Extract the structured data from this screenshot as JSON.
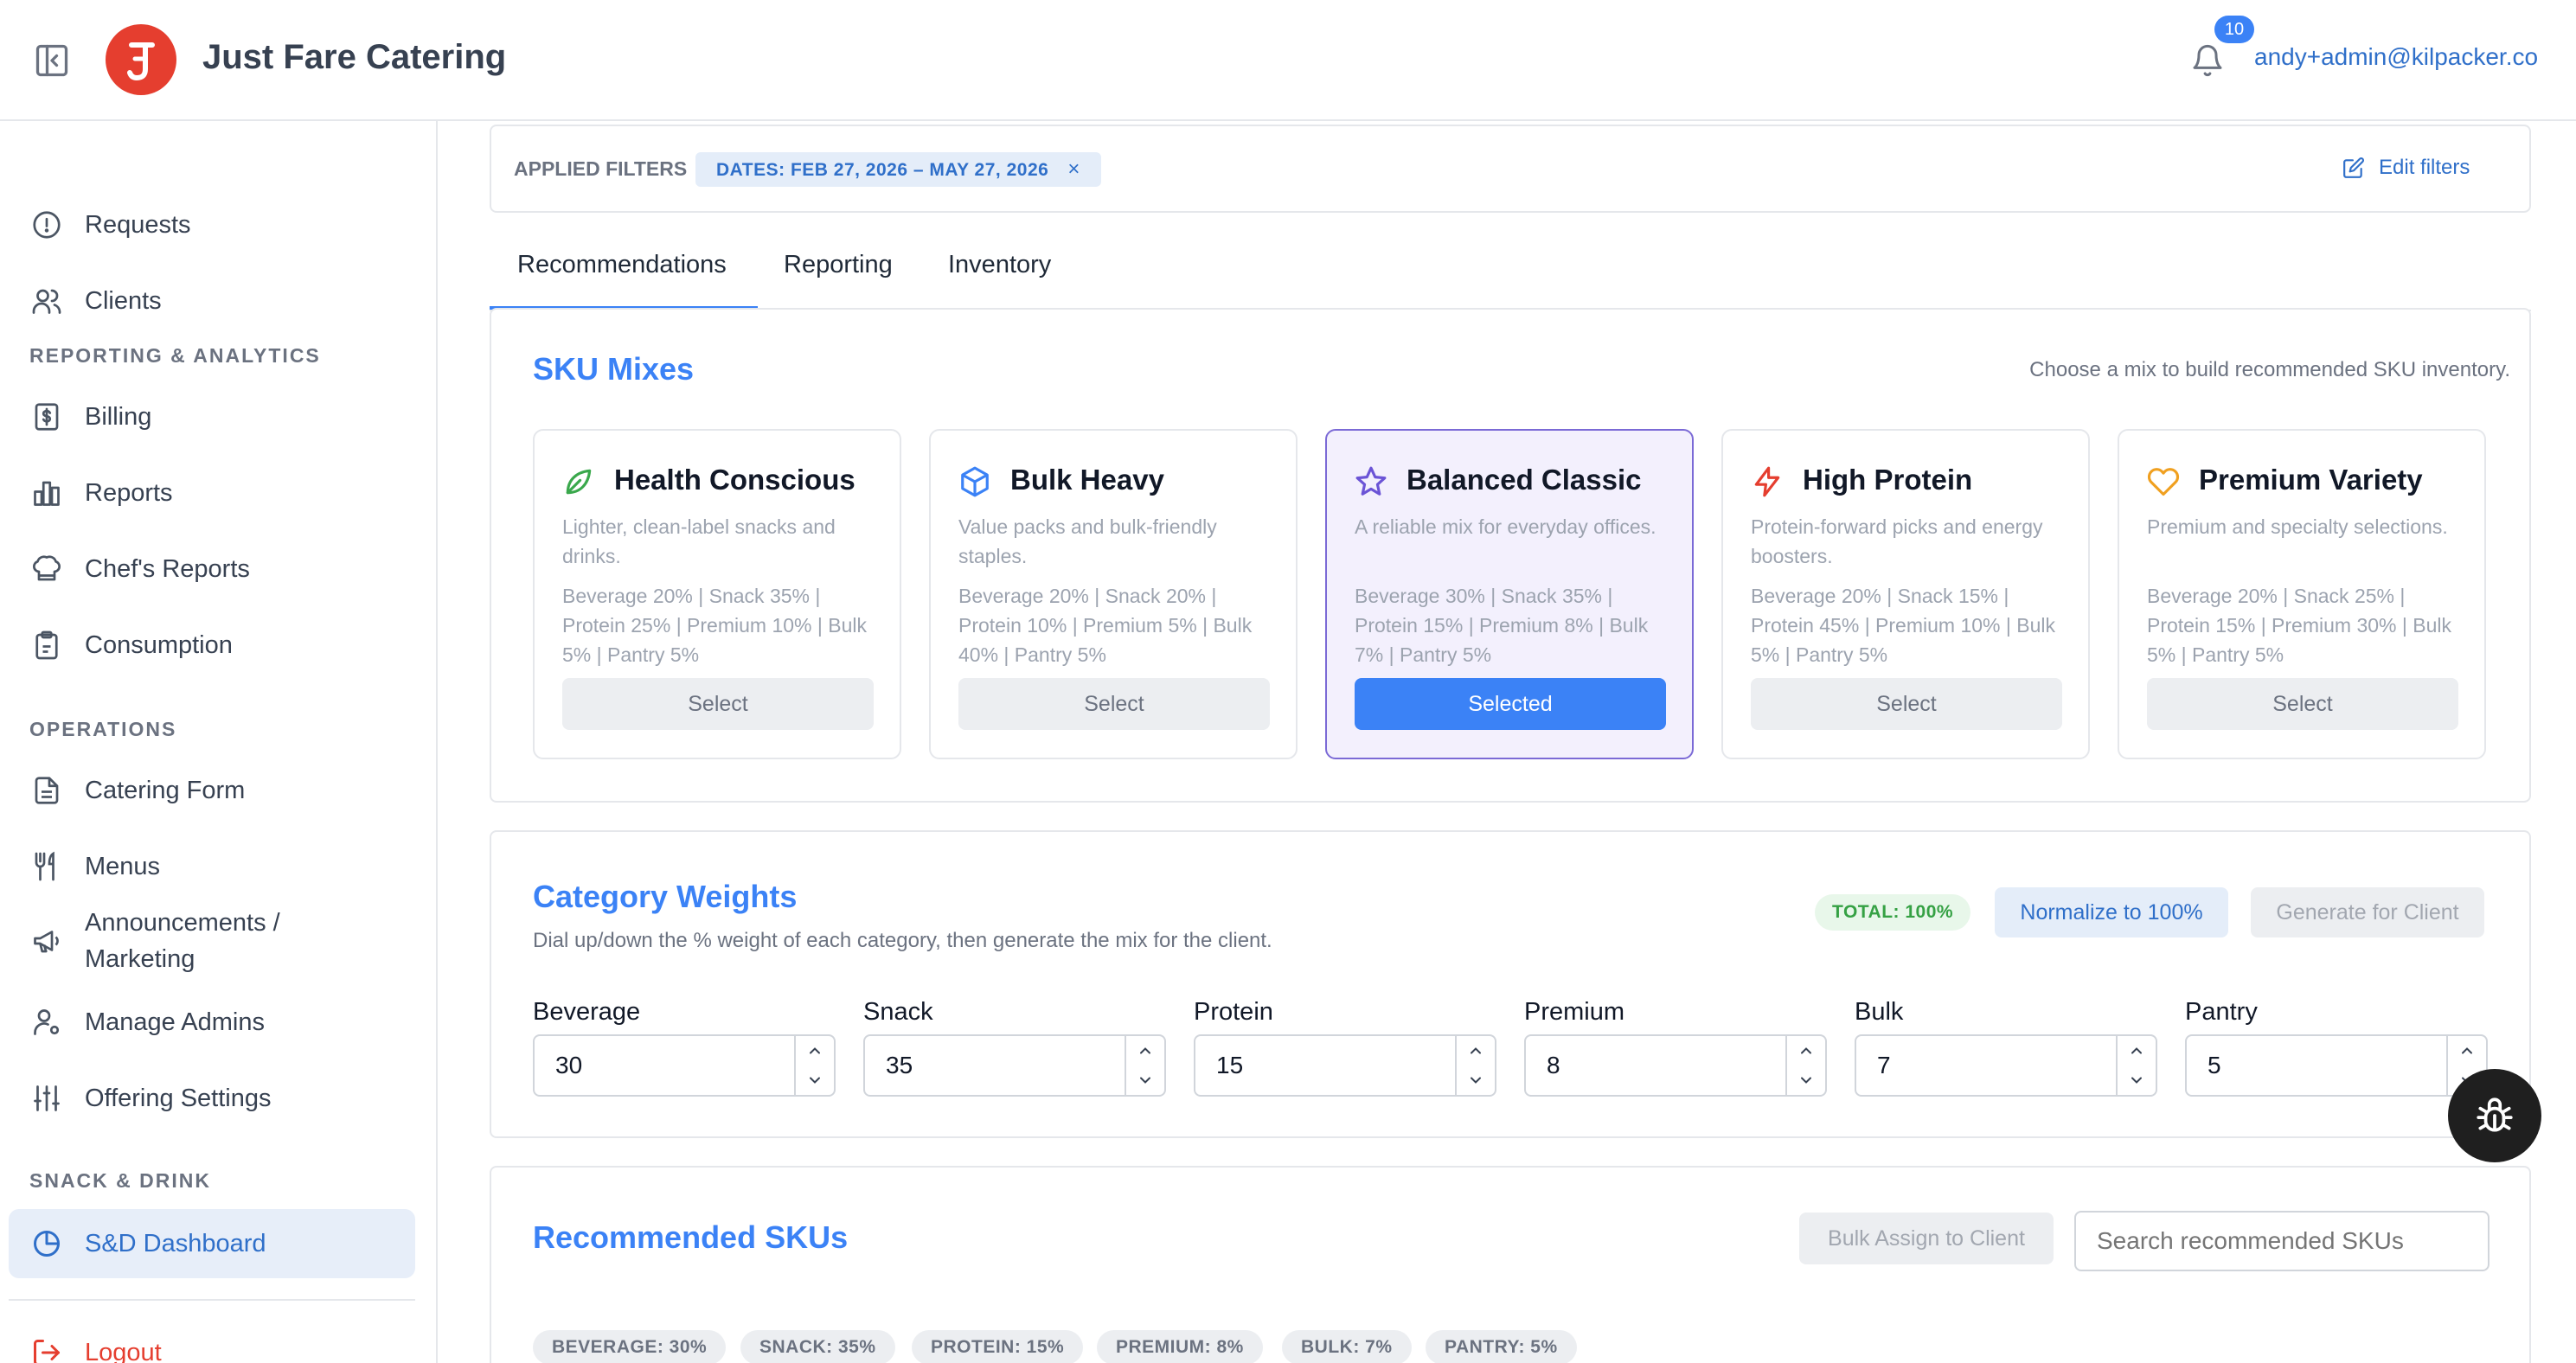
{
  "app": {
    "title": "Just Fare Catering",
    "notification_count": "10",
    "user_email": "andy+admin@kilpacker.co",
    "brand_color": "#e53e2f",
    "accent_color": "#3b82f6"
  },
  "sidebar": {
    "items_top": [
      {
        "label": "Requests",
        "icon": "alert-circle-icon"
      },
      {
        "label": "Clients",
        "icon": "users-icon"
      }
    ],
    "section_reporting": "REPORTING & ANALYTICS",
    "items_reporting": [
      {
        "label": "Billing",
        "icon": "dollar-doc-icon"
      },
      {
        "label": "Reports",
        "icon": "bar-chart-icon"
      },
      {
        "label": "Chef's Reports",
        "icon": "chef-hat-icon"
      },
      {
        "label": "Consumption",
        "icon": "clipboard-icon"
      }
    ],
    "section_operations": "OPERATIONS",
    "items_operations": [
      {
        "label": "Catering Form",
        "icon": "document-icon"
      },
      {
        "label": "Menus",
        "icon": "utensils-icon"
      },
      {
        "label": "Announcements / Marketing",
        "icon": "megaphone-icon"
      },
      {
        "label": "Manage Admins",
        "icon": "user-gear-icon"
      },
      {
        "label": "Offering Settings",
        "icon": "sliders-icon"
      }
    ],
    "section_snack": "SNACK & DRINK",
    "items_snack": [
      {
        "label": "S&D Dashboard",
        "icon": "pie-chart-icon",
        "active": true
      }
    ],
    "logout_label": "Logout"
  },
  "filters": {
    "label": "APPLIED FILTERS",
    "chip": "DATES: FEB 27, 2026 – MAY 27, 2026",
    "chip_remove": "×",
    "edit_label": "Edit filters"
  },
  "tabs": [
    {
      "label": "Recommendations",
      "active": true
    },
    {
      "label": "Reporting"
    },
    {
      "label": "Inventory"
    }
  ],
  "sku_mixes": {
    "title": "SKU Mixes",
    "hint": "Choose a mix to build recommended SKU inventory.",
    "cards": [
      {
        "title": "Health Conscious",
        "icon": "leaf-icon",
        "description": "Lighter, clean-label snacks and drinks.",
        "split": "Beverage 20% | Snack 35% | Protein 25% | Premium 10% | Bulk 5% | Pantry 5%",
        "button": "Select",
        "selected": false
      },
      {
        "title": "Bulk Heavy",
        "icon": "box-icon",
        "description": "Value packs and bulk-friendly staples.",
        "split": "Beverage 20% | Snack 20% | Protein 10% | Premium 5% | Bulk 40% | Pantry 5%",
        "button": "Select",
        "selected": false
      },
      {
        "title": "Balanced Classic",
        "icon": "star-icon",
        "description": "A reliable mix for everyday offices.",
        "split": "Beverage 30% | Snack 35% | Protein 15% | Premium 8% | Bulk 7% | Pantry 5%",
        "button": "Selected",
        "selected": true
      },
      {
        "title": "High Protein",
        "icon": "lightning-icon",
        "description": "Protein-forward picks and energy boosters.",
        "split": "Beverage 20% | Snack 15% | Protein 45% | Premium 10% | Bulk 5% | Pantry 5%",
        "button": "Select",
        "selected": false
      },
      {
        "title": "Premium Variety",
        "icon": "heart-icon",
        "description": "Premium and specialty selections.",
        "split": "Beverage 20% | Snack 25% | Protein 15% | Premium 30% | Bulk 5% | Pantry 5%",
        "button": "Select",
        "selected": false
      }
    ]
  },
  "category_weights": {
    "title": "Category Weights",
    "subtitle": "Dial up/down the % weight of each category, then generate the mix for the client.",
    "total_badge": "TOTAL: 100%",
    "normalize_label": "Normalize to 100%",
    "generate_label": "Generate for Client",
    "fields": [
      {
        "label": "Beverage",
        "value": "30"
      },
      {
        "label": "Snack",
        "value": "35"
      },
      {
        "label": "Protein",
        "value": "15"
      },
      {
        "label": "Premium",
        "value": "8"
      },
      {
        "label": "Bulk",
        "value": "7"
      },
      {
        "label": "Pantry",
        "value": "5"
      }
    ]
  },
  "recommended": {
    "title": "Recommended SKUs",
    "bulk_assign_label": "Bulk Assign to Client",
    "search_placeholder": "Search recommended SKUs",
    "pills": [
      "BEVERAGE: 30%",
      "SNACK: 35%",
      "PROTEIN: 15%",
      "PREMIUM: 8%",
      "BULK: 7%",
      "PANTRY: 5%"
    ]
  }
}
